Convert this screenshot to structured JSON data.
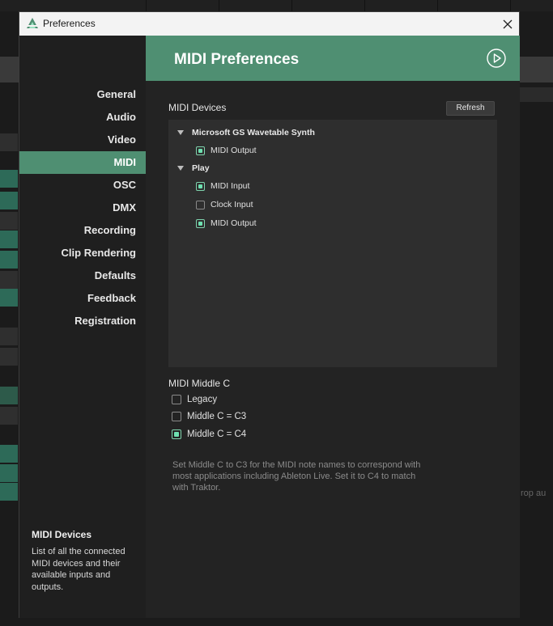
{
  "window": {
    "title": "Preferences"
  },
  "header": {
    "title": "MIDI Preferences"
  },
  "nav": [
    {
      "label": "General",
      "active": false
    },
    {
      "label": "Audio",
      "active": false
    },
    {
      "label": "Video",
      "active": false
    },
    {
      "label": "MIDI",
      "active": true
    },
    {
      "label": "OSC",
      "active": false
    },
    {
      "label": "DMX",
      "active": false
    },
    {
      "label": "Recording",
      "active": false
    },
    {
      "label": "Clip Rendering",
      "active": false
    },
    {
      "label": "Defaults",
      "active": false
    },
    {
      "label": "Feedback",
      "active": false
    },
    {
      "label": "Registration",
      "active": false
    }
  ],
  "help": {
    "title": "MIDI Devices",
    "body": "List of all the connected MIDI devices and their available inputs and outputs."
  },
  "midi_devices": {
    "label": "MIDI Devices",
    "refresh_label": "Refresh",
    "devices": [
      {
        "name": "Microsoft GS Wavetable Synth",
        "options": [
          {
            "label": "MIDI Output",
            "checked": true
          }
        ]
      },
      {
        "name": "Play",
        "options": [
          {
            "label": "MIDI Input",
            "checked": true
          },
          {
            "label": "Clock Input",
            "checked": false
          },
          {
            "label": "MIDI Output",
            "checked": true
          }
        ]
      }
    ]
  },
  "middle_c": {
    "label": "MIDI Middle C",
    "options": [
      {
        "label": "Legacy",
        "checked": false
      },
      {
        "label": "Middle C = C3",
        "checked": false
      },
      {
        "label": "Middle C = C4",
        "checked": true
      }
    ],
    "note": "Set Middle C to C3 for the MIDI note names to correspond with most applications including Ableton Live. Set it to C4 to match with Traktor."
  },
  "background": {
    "partial_text": "rop au"
  },
  "colors": {
    "accent": "#4f8f72",
    "check": "#6ee0b0"
  }
}
